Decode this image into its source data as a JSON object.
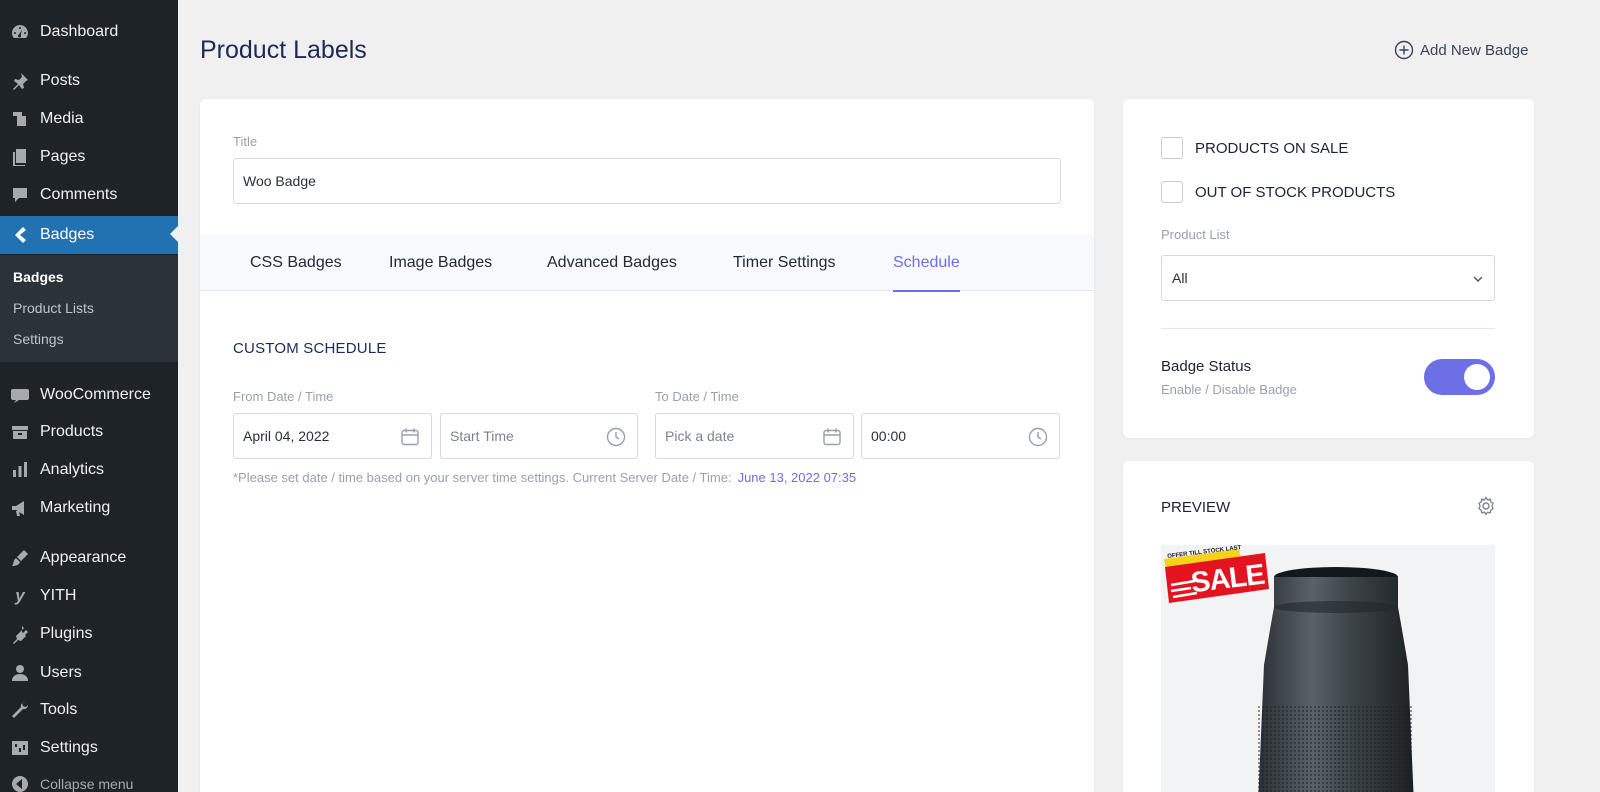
{
  "sidebar": {
    "items": [
      {
        "label": "Dashboard",
        "icon": "dashboard-icon"
      },
      {
        "label": "Posts",
        "icon": "pin-icon"
      },
      {
        "label": "Media",
        "icon": "media-icon"
      },
      {
        "label": "Pages",
        "icon": "pages-icon"
      },
      {
        "label": "Comments",
        "icon": "comment-icon"
      },
      {
        "label": "Badges",
        "icon": "badge-icon"
      },
      {
        "label": "WooCommerce",
        "icon": "woo-icon"
      },
      {
        "label": "Products",
        "icon": "archive-icon"
      },
      {
        "label": "Analytics",
        "icon": "bar-chart-icon"
      },
      {
        "label": "Marketing",
        "icon": "megaphone-icon"
      },
      {
        "label": "Appearance",
        "icon": "brush-icon"
      },
      {
        "label": "YITH",
        "icon": "yith-icon"
      },
      {
        "label": "Plugins",
        "icon": "plugin-icon"
      },
      {
        "label": "Users",
        "icon": "user-icon"
      },
      {
        "label": "Tools",
        "icon": "wrench-icon"
      },
      {
        "label": "Settings",
        "icon": "settings-icon"
      }
    ],
    "submenu": [
      "Badges",
      "Product Lists",
      "Settings"
    ],
    "collapse_label": "Collapse menu"
  },
  "header": {
    "title": "Product Labels",
    "add_new_label": "Add New Badge"
  },
  "form": {
    "title_label": "Title",
    "title_value": "Woo Badge",
    "tabs": [
      "CSS Badges",
      "Image Badges",
      "Advanced Badges",
      "Timer Settings",
      "Schedule"
    ],
    "active_tab": "Schedule",
    "section_title": "CUSTOM SCHEDULE",
    "from_label": "From Date / Time",
    "to_label": "To Date / Time",
    "from_date": "April 04, 2022",
    "from_time_placeholder": "Start Time",
    "to_date_placeholder": "Pick a date",
    "to_time": "00:00",
    "note": "*Please set date / time based on your server time settings. Current Server Date / Time:",
    "server_time": "June 13, 2022 07:35"
  },
  "side": {
    "products_on_sale": "PRODUCTS ON SALE",
    "out_of_stock": "OUT OF STOCK PRODUCTS",
    "product_list_label": "Product List",
    "product_list_value": "All",
    "status_title": "Badge Status",
    "status_sub": "Enable / Disable Badge",
    "status_enabled": true
  },
  "preview": {
    "title": "PREVIEW",
    "badge_small": "OFFER TILL STOCK LAST",
    "badge_big": "SALE"
  },
  "colors": {
    "accent": "#6d6fe6",
    "sidebar_bg": "#1d2327",
    "active_menu": "#2271b1",
    "sale_red": "#e3141f",
    "sale_yellow": "#f6d21b"
  }
}
